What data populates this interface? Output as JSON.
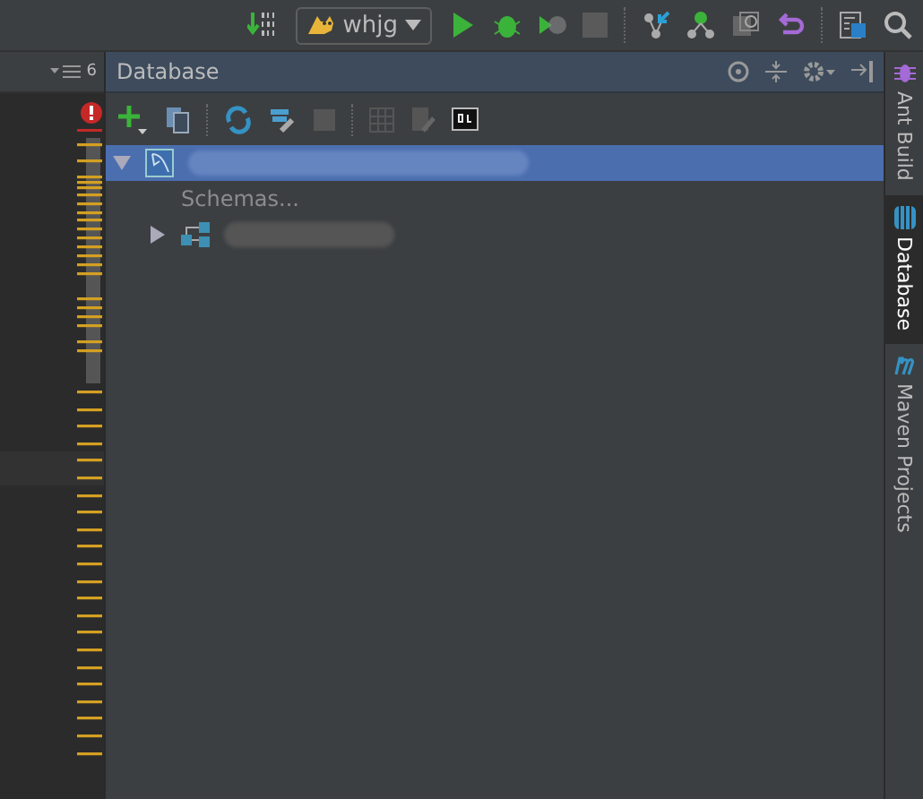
{
  "toolbar": {
    "run_config": "whjg"
  },
  "editor": {
    "fold_count": "6"
  },
  "panel": {
    "title": "Database"
  },
  "tree": [
    {
      "kind": "datasource",
      "expanded": true,
      "selected": true,
      "children": [
        {
          "kind": "label",
          "text": "Schemas..."
        },
        {
          "kind": "schema",
          "expanded": false
        }
      ]
    }
  ],
  "side_tabs": [
    {
      "label": "Ant Build",
      "kind": "ant",
      "selected": false
    },
    {
      "label": "Database",
      "kind": "database",
      "selected": true
    },
    {
      "label": "Maven Projects",
      "kind": "maven",
      "selected": false
    }
  ]
}
